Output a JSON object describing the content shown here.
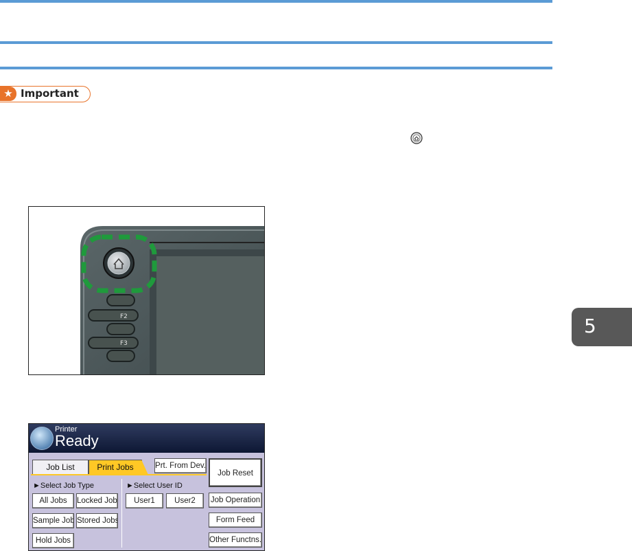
{
  "document": {
    "important_label": "Important",
    "chapter_number": "5",
    "home_glyph_icon": "home-key-icon"
  },
  "figure_photo": {
    "keys": [
      "F2",
      "F3"
    ]
  },
  "printer_panel": {
    "title": "Printer",
    "status": "Ready",
    "tabs": [
      {
        "label": "Job List"
      },
      {
        "label": "Print Jobs"
      }
    ],
    "prt_from_dev": "Prt. From Dev.",
    "select_job_type": "►Select Job Type",
    "select_user_id": "►Select User ID",
    "job_type_buttons": [
      "All Jobs",
      "Locked Jobs",
      "Sample Jobs",
      "Stored Jobs",
      "Hold Jobs"
    ],
    "user_buttons": [
      "User1",
      "User2"
    ],
    "right_buttons": [
      "Job Reset",
      "Job Operation",
      "Form Feed",
      "Other Functns."
    ],
    "accent_color": "#ffc825"
  }
}
